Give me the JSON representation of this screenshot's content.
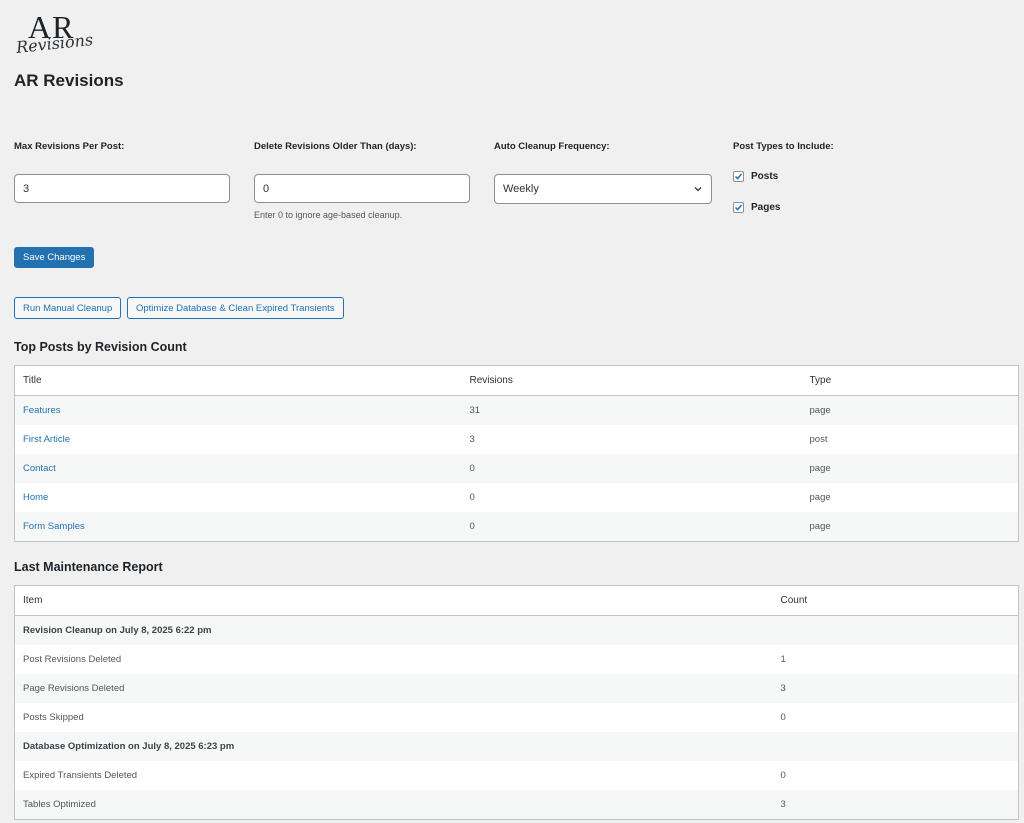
{
  "logo": {
    "ar": "AR",
    "script": "Revisions"
  },
  "page_title": "AR Revisions",
  "settings": {
    "max_revisions": {
      "label": "Max Revisions Per Post:",
      "value": "3"
    },
    "delete_older": {
      "label": "Delete Revisions Older Than (days):",
      "value": "0",
      "hint": "Enter 0 to ignore age-based cleanup."
    },
    "frequency": {
      "label": "Auto Cleanup Frequency:",
      "value": "Weekly"
    },
    "post_types": {
      "label": "Post Types to Include:",
      "posts": "Posts",
      "pages": "Pages"
    }
  },
  "buttons": {
    "save": "Save Changes",
    "manual_cleanup": "Run Manual Cleanup",
    "optimize": "Optimize Database & Clean Expired Transients"
  },
  "top_posts": {
    "title": "Top Posts by Revision Count",
    "headers": [
      "Title",
      "Revisions",
      "Type"
    ],
    "rows": [
      [
        "Features",
        "31",
        "page"
      ],
      [
        "First Article",
        "3",
        "post"
      ],
      [
        "Contact",
        "0",
        "page"
      ],
      [
        "Home",
        "0",
        "page"
      ],
      [
        "Form Samples",
        "0",
        "page"
      ]
    ]
  },
  "report": {
    "title": "Last Maintenance Report",
    "headers": [
      "Item",
      "Count"
    ],
    "rows": [
      [
        "Revision Cleanup on July 8, 2025 6:22 pm",
        ""
      ],
      [
        "Post Revisions Deleted",
        "1"
      ],
      [
        "Page Revisions Deleted",
        "3"
      ],
      [
        "Posts Skipped",
        "0"
      ],
      [
        "Database Optimization on July 8, 2025 6:23 pm",
        ""
      ],
      [
        "Expired Transients Deleted",
        "0"
      ],
      [
        "Tables Optimized",
        "3"
      ]
    ]
  },
  "colors": {
    "accent": "#2271b1",
    "background": "#f0f0f1"
  }
}
